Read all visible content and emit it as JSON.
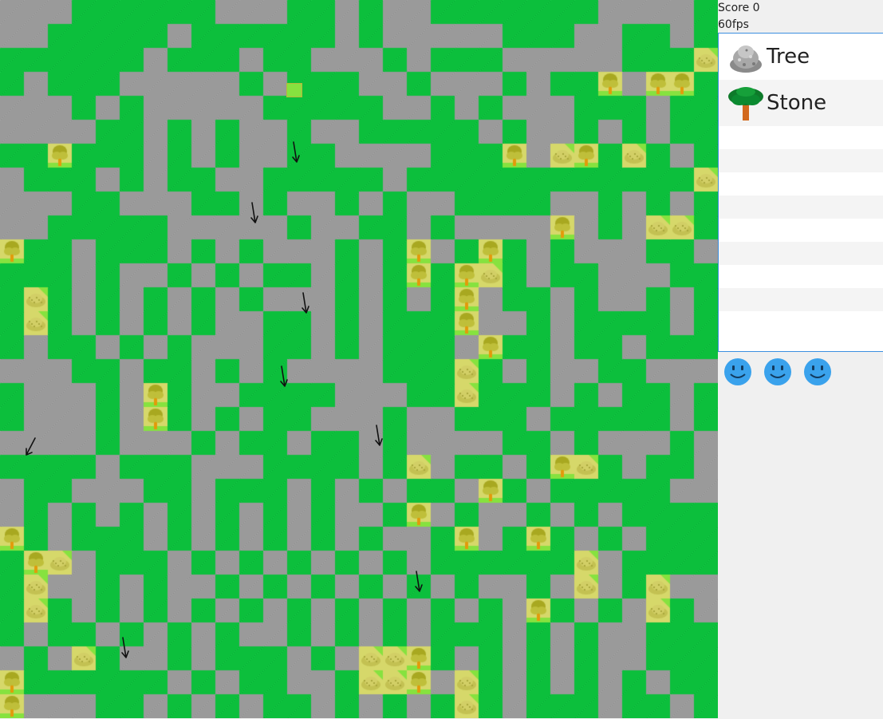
{
  "hud": {
    "score_label": "Score 0",
    "fps_label": "60fps"
  },
  "inventory": {
    "items": [
      {
        "label": "Tree",
        "icon": "rock-pile-icon"
      },
      {
        "label": "Stone",
        "icon": "tree-icon"
      }
    ]
  },
  "lives": {
    "count": 3,
    "icon": "smiley-face-icon"
  },
  "board": {
    "cols": 30,
    "rows": 30,
    "legend": {
      "g": "grass",
      "s": "stone-floor",
      "t": "tree",
      "r": "rock-pile"
    },
    "tiles": [
      "sssggggggsssggsgssgggggggssssg",
      "ssgggggsggggggsgsssssgggssggsg",
      "ggggggsgggsggsssgsgggsssssgggr",
      "gsgggsssssgsgggssgsssgsggtsttg",
      "sssgsgsssssgggggssgsgsssgggsgg",
      "ssssggsgsgssgssgggggsgssgsgsgg",
      "ggtgggsgsgssggssssgggtsrtgrgsg",
      "sgggsgsggssgggggsggggggggggggr",
      "sssggsssggsgssgsgssggggssgsgsg",
      "ssgggggsssssgssggsgsssstsgsrrg",
      "tggsgggsgsgsssgsgtsgtgsgsssggs",
      "gggsgssgsgsggsgsgtgtrgsggsssgg",
      "grgsgsgsgsgsssgsgsgtsggsgssgsg",
      "grgsgsgsgssggsgsgggtssgsggggsg",
      "gsggsgsgsssggsgsgggstggsggsggg",
      "sssggsggsgsgssssgggrgsgssggsss",
      "gsssgstgssggggsssggrgggsgsggsg",
      "gsssgstgsgsggsssgssgggsgggggsg",
      "ssssgsssgsggsggsgssssggsgsssgs",
      "ggggsgggsssggggsgrsggsgtrgsggs",
      "sggsssggsgggsgsgsggstgsgggggss",
      "sgsgsgsgsgsgsgssgtsgssgsgsgggg",
      "tgsgggsgsgsgsgsgssgtsgtgsgsggg",
      "gtrsgggsgsgsgsgsgsggggggrsgggg",
      "grssgsgssgsgsgsgsgsgssgsrsgrss",
      "grgsgsgsgsgsgsgsgsgsgstgsgsrgs",
      "gsggsgsgsgssgsgsgsgggsgsgssggg",
      "sgsrgssgsgggsgsrrtgsgsgsgssggg",
      "tggggggsgsggssgrrtsrgsgsgsgsgg",
      "tsssggsgsgsggsgsgsgrgsgggsggsg"
    ],
    "arrows": [
      {
        "direction": "down"
      },
      {
        "direction": "down"
      },
      {
        "direction": "down"
      },
      {
        "direction": "down"
      },
      {
        "direction": "down"
      },
      {
        "direction": "down-left"
      },
      {
        "direction": "down"
      },
      {
        "direction": "down"
      }
    ]
  },
  "colors": {
    "grass": "#0cbf3c",
    "stone_floor": "#9a9a9a",
    "tile_sand": "#d6d86a",
    "tile_light_grass": "#86e23f",
    "inventory_border": "#3c8fe0",
    "life_blue": "#3aa2ec",
    "arrow": "#111111"
  }
}
